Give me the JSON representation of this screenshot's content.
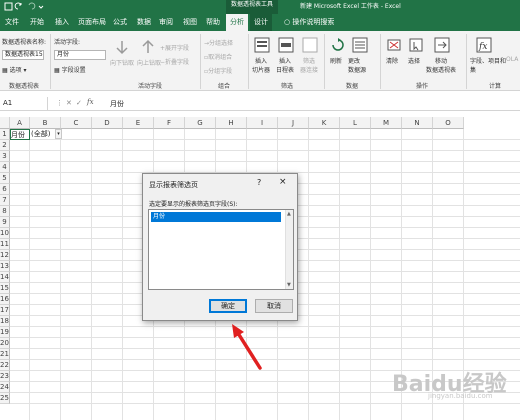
{
  "titlebar": {
    "context_tab_group": "数据透视表工具",
    "window_title": "新建 Microsoft Excel 工作表 - Excel"
  },
  "tabs": [
    "文件",
    "开始",
    "插入",
    "页面布局",
    "公式",
    "数据",
    "审阅",
    "视图",
    "帮助",
    "分析",
    "设计"
  ],
  "active_tab": "分析",
  "tell_me": "操作说明搜索",
  "ribbon": {
    "pivot_name_label": "数据透视表名称:",
    "pivot_name_value": "数据透视表15",
    "options_label": "选项",
    "active_field_label": "活动字段:",
    "active_field_value": "月份",
    "field_settings": "字段设置",
    "drill_down": "向下钻取",
    "drill_up": "向上钻取",
    "expand_field": "展开字段",
    "collapse_field": "折叠字段",
    "group_selection": "分组选择",
    "ungroup": "取消组合",
    "group_field": "分组字段",
    "insert_slicer": "插入\n切片器",
    "insert_timeline": "插入\n日程表",
    "filter_connections": "筛选\n器连接",
    "refresh": "刷新",
    "change_source": "更改\n数据源",
    "clear": "清除",
    "select": "选择",
    "move_pivot": "移动\n数据透视表",
    "fields_items": "字段、项目和\n集",
    "olap": "OLA",
    "groups": [
      "数据透视表",
      "活动字段",
      "组合",
      "筛选",
      "数据",
      "操作",
      "计算"
    ]
  },
  "formula_bar": {
    "name_box": "A1",
    "fx": "fx",
    "value": "月份"
  },
  "sheet": {
    "columns": [
      "A",
      "B",
      "C",
      "D",
      "E",
      "F",
      "G",
      "H",
      "I",
      "J",
      "K",
      "L",
      "M",
      "N",
      "O"
    ],
    "rows": [
      "1",
      "2",
      "3",
      "4",
      "5",
      "6",
      "7",
      "8",
      "9",
      "10",
      "11",
      "12",
      "13",
      "14",
      "15",
      "16",
      "17",
      "18",
      "19",
      "20",
      "21",
      "22",
      "23",
      "24",
      "25"
    ],
    "a1": "月份",
    "b1": "(全部)"
  },
  "dialog": {
    "title": "显示报表筛选页",
    "help": "?",
    "close": "×",
    "prompt": "选定要显示的报表筛选页字段(S):",
    "items": [
      "月份"
    ],
    "ok": "确定",
    "cancel": "取消"
  },
  "watermark": {
    "main": "Baidu经验",
    "sub": "jingyan.baidu.com"
  }
}
